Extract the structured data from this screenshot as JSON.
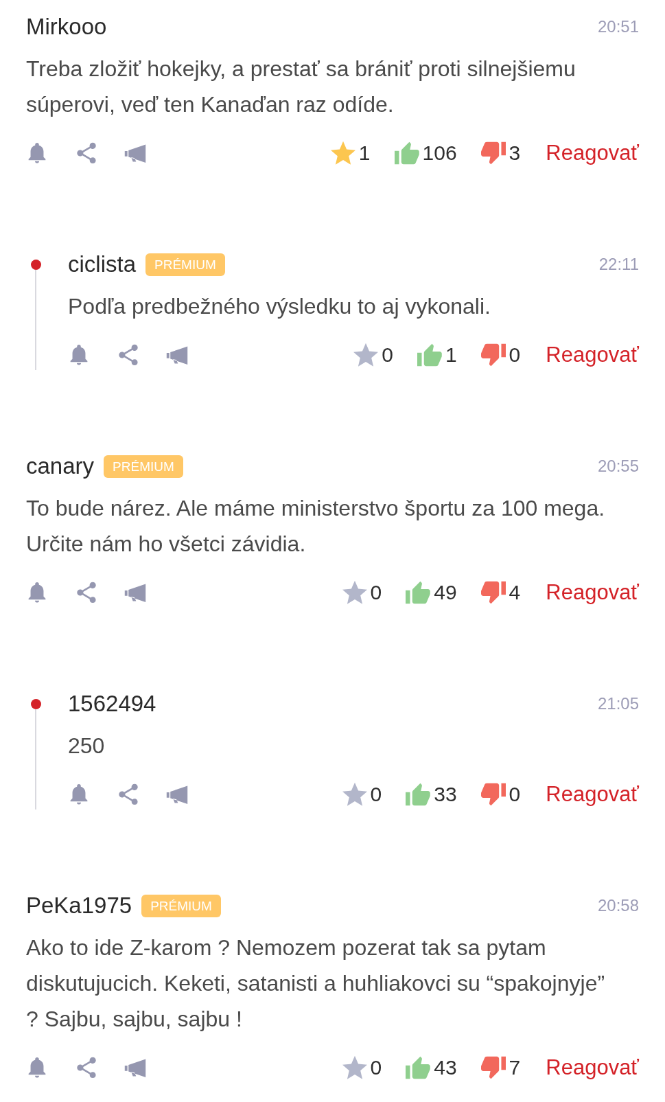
{
  "comments": [
    {
      "author": "Mirkooo",
      "time": "20:51",
      "text": "Treba zložiť hokejky, a prestať sa brániť proti silnejšiemu súperovi, veď ten Kanaďan raz odíde.",
      "starred": true,
      "favorites": "1",
      "likes": "106",
      "dislikes": "3",
      "reply_label": "Reagovať",
      "replies": [
        {
          "author": "ciclista",
          "badge": "PRÉMIUM",
          "time": "22:11",
          "text": "Podľa predbežného výsledku to aj vykonali.",
          "starred": false,
          "favorites": "0",
          "likes": "1",
          "dislikes": "0",
          "reply_label": "Reagovať"
        }
      ]
    },
    {
      "author": "canary",
      "badge": "PRÉMIUM",
      "time": "20:55",
      "text": "To bude nárez. Ale máme ministerstvo športu za 100 mega. Určite nám ho všetci závidia.",
      "starred": false,
      "favorites": "0",
      "likes": "49",
      "dislikes": "4",
      "reply_label": "Reagovať",
      "replies": [
        {
          "author": "1562494",
          "time": "21:05",
          "text": "250",
          "starred": false,
          "favorites": "0",
          "likes": "33",
          "dislikes": "0",
          "reply_label": "Reagovať"
        }
      ]
    },
    {
      "author": "PeKa1975",
      "badge": "PRÉMIUM",
      "time": "20:58",
      "text": "Ako to ide Z-karom ? Nemozem pozerat tak sa pytam diskutujucich. Keketi, satanisti a huhliakovci su “spakojnyje” ? Sajbu, sajbu, sajbu !",
      "starred": false,
      "favorites": "0",
      "likes": "43",
      "dislikes": "7",
      "reply_label": "Reagovať"
    }
  ]
}
